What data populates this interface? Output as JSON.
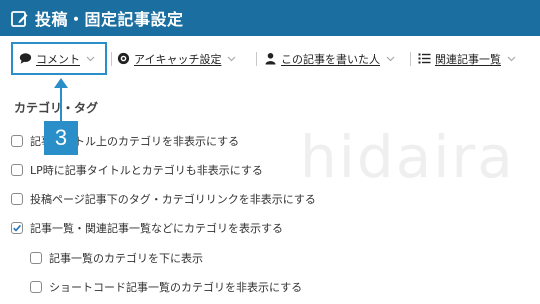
{
  "header": {
    "title": "投稿・固定記事設定",
    "icon": "edit-note-icon",
    "background": "#1a6fa0"
  },
  "tabs": [
    {
      "label": "コメント",
      "icon": "comment-bubble-icon",
      "active": true
    },
    {
      "label": "アイキャッチ設定",
      "icon": "eye-icon",
      "active": false
    },
    {
      "label": "この記事を書いた人",
      "icon": "person-icon",
      "active": false
    },
    {
      "label": "関連記事一覧",
      "icon": "list-icon",
      "active": false
    }
  ],
  "watermark": "hidaira",
  "section": {
    "title": "カテゴリ・タグ"
  },
  "options": [
    {
      "label": "記事タイトル上のカテゴリを非表示にする",
      "checked": false,
      "indent": false
    },
    {
      "label": "LP時に記事タイトルとカテゴリも非表示にする",
      "checked": false,
      "indent": false
    },
    {
      "label": "投稿ページ記事下のタグ・カテゴリリンクを非表示にする",
      "checked": false,
      "indent": false
    },
    {
      "label": "記事一覧・関連記事一覧などにカテゴリを表示する",
      "checked": true,
      "indent": false
    },
    {
      "label": "記事一覧のカテゴリを下に表示",
      "checked": false,
      "indent": true
    },
    {
      "label": "ショートコード記事一覧のカテゴリを非表示にする",
      "checked": false,
      "indent": true
    }
  ],
  "callout": {
    "number": "3",
    "color": "#2a8fc9"
  }
}
